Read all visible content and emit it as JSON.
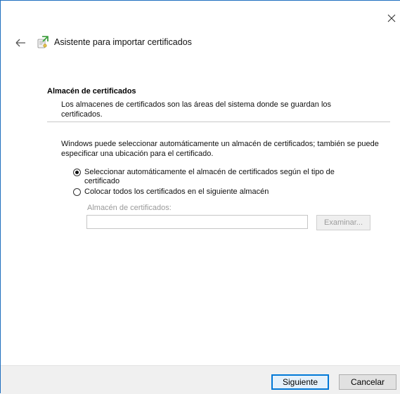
{
  "window": {
    "title": "Asistente para importar certificados",
    "accent": "#0078d7"
  },
  "section": {
    "title": "Almacén de certificados",
    "description": "Los almacenes de certificados son las áreas del sistema donde se guardan los certificados."
  },
  "intro": "Windows puede seleccionar automáticamente un almacén de certificados; también se puede especificar una ubicación para el certificado.",
  "options": [
    {
      "label": "Seleccionar automáticamente el almacén de certificados según el tipo de certificado",
      "selected": true
    },
    {
      "label": "Colocar todos los certificados en el siguiente almacén",
      "selected": false
    }
  ],
  "store": {
    "label": "Almacén de certificados:",
    "value": "",
    "browse_label": "Examinar..."
  },
  "buttons": {
    "next": "Siguiente",
    "cancel": "Cancelar"
  },
  "icons": {
    "close": "close-icon",
    "back": "back-arrow-icon",
    "wizard": "certificate-wizard-icon"
  }
}
